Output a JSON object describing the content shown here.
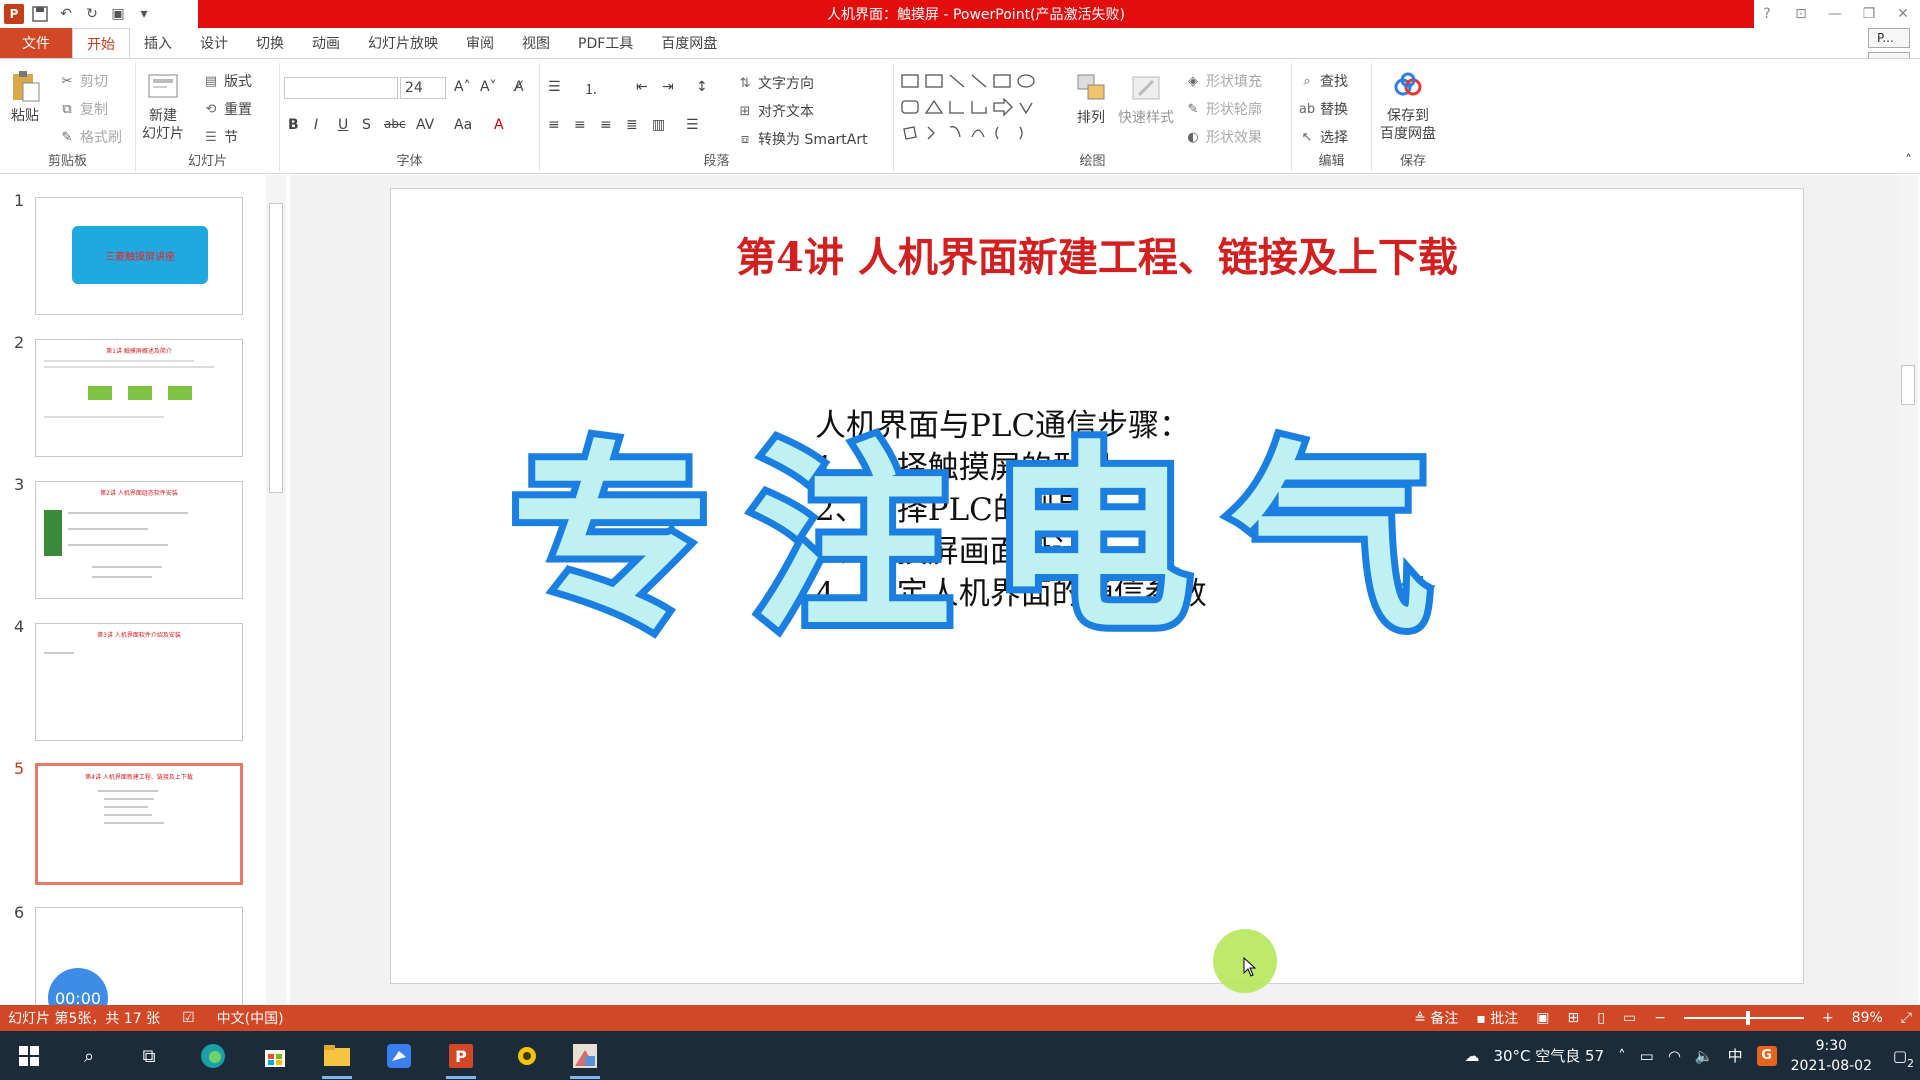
{
  "window": {
    "title": "人机界面：触摸屏 - PowerPoint(产品激活失败)",
    "login": "P...",
    "start": "开始"
  },
  "ribbon_tabs": [
    "文件",
    "开始",
    "插入",
    "设计",
    "切换",
    "动画",
    "幻灯片放映",
    "审阅",
    "视图",
    "PDF工具",
    "百度网盘"
  ],
  "ribbon": {
    "clipboard": {
      "name": "剪贴板",
      "paste": "粘贴",
      "cut": "剪切",
      "copy": "复制",
      "format_painter": "格式刷"
    },
    "slides": {
      "name": "幻灯片",
      "new_slide": "新建\n幻灯片",
      "layout": "版式",
      "reset": "重置",
      "section": "节"
    },
    "font": {
      "name": "字体",
      "font_size": "24",
      "bold": "B",
      "italic": "I",
      "underline": "U",
      "shadow": "S",
      "strike": "abc",
      "spacing": "AV",
      "case": "Aa",
      "color": "A"
    },
    "paragraph": {
      "name": "段落",
      "text_direction": "文字方向",
      "align_text": "对齐文本",
      "smartart": "转换为 SmartArt"
    },
    "drawing": {
      "name": "绘图",
      "arrange": "排列",
      "quick_styles": "快速样式",
      "shape_fill": "形状填充",
      "shape_outline": "形状轮廓",
      "shape_effects": "形状效果"
    },
    "editing": {
      "name": "编辑",
      "find": "查找",
      "replace": "替换",
      "select": "选择"
    },
    "save": {
      "name": "保存",
      "save_baidu": "保存到\n百度网盘"
    }
  },
  "thumbnails": [
    {
      "num": "1",
      "text": "三菱触摸屏讲座"
    },
    {
      "num": "2",
      "text": "第1讲 触摸屏概述及简介"
    },
    {
      "num": "3",
      "text": "第2讲 人机界面组态软件安装"
    },
    {
      "num": "4",
      "text": "第3讲 人机界面软件介绍及安装"
    },
    {
      "num": "5",
      "text": "第4讲 人机界面新建工程、链接及上下载"
    },
    {
      "num": "6",
      "text": ""
    }
  ],
  "timer": "00:00",
  "slide": {
    "title": "第4讲  人机界面新建工程、链接及上下载",
    "body": [
      "人机界面与PLC通信步骤：",
      "1、选择触摸屏的型号",
      "2、选择PLC的型号",
      "3、触摸屏画面设计",
      "4、设定人机界面的通信参数"
    ],
    "watermark": "专注电气"
  },
  "status": {
    "slide_info": "幻灯片 第5张，共 17 张",
    "language": "中文(中国)",
    "notes": "备注",
    "comments": "批注",
    "zoom": "89%"
  },
  "taskbar": {
    "weather": "30°C 空气良 57",
    "ime": "中",
    "time": "9:30",
    "date": "2021-08-02",
    "notifications": "2"
  }
}
